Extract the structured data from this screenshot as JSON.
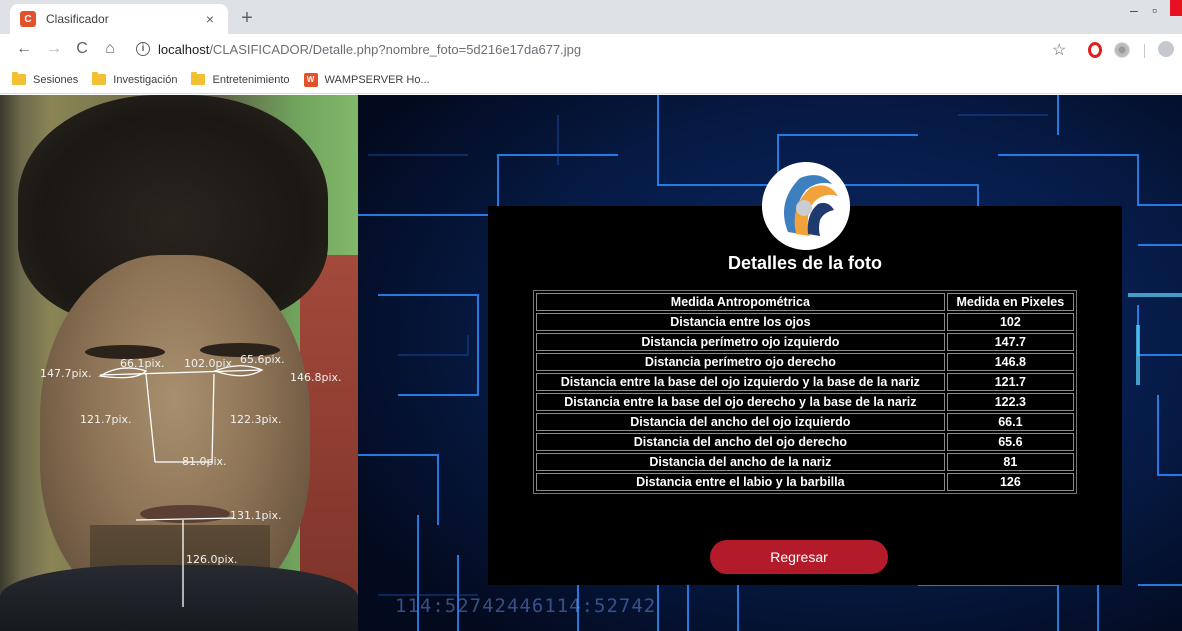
{
  "browser": {
    "tab_title": "Clasificador",
    "tab_favicon_text": "C",
    "url_host": "localhost",
    "url_path": "/CLASIFICADOR/Detalle.php?nombre_foto=5d216e17da677.jpg",
    "bookmarks": [
      {
        "label": "Sesiones",
        "icon": "folder-icon"
      },
      {
        "label": "Investigación",
        "icon": "folder-icon"
      },
      {
        "label": "Entretenimiento",
        "icon": "folder-icon"
      },
      {
        "label": "WAMPSERVER Ho...",
        "icon": "wamp-icon"
      }
    ]
  },
  "photo_overlay": {
    "labels": {
      "left_perimeter": "147.7pix.",
      "left_width": "66.1pix.",
      "eye_distance": "102.0pix.",
      "right_width": "65.6pix.",
      "right_perimeter": "146.8pix.",
      "left_eye_nose": "121.7pix.",
      "right_eye_nose": "122.3pix.",
      "nose_width": "81.0pix.",
      "lip_width": "131.1pix.",
      "lip_chin": "126.0pix."
    }
  },
  "background": {
    "circuit_text": "114:52742446114:52742"
  },
  "panel": {
    "title": "Detalles de la foto",
    "table": {
      "headers": [
        "Medida Antropométrica",
        "Medida en Pixeles"
      ],
      "rows": [
        [
          "Distancia entre los ojos",
          "102"
        ],
        [
          "Distancia perímetro ojo izquierdo",
          "147.7"
        ],
        [
          "Distancia perímetro ojo derecho",
          "146.8"
        ],
        [
          "Distancia entre la base del ojo izquierdo y la base de la nariz",
          "121.7"
        ],
        [
          "Distancia entre la base del ojo derecho y la base de la nariz",
          "122.3"
        ],
        [
          "Distancia del ancho del ojo izquierdo",
          "66.1"
        ],
        [
          "Distancia del ancho del ojo derecho",
          "65.6"
        ],
        [
          "Distancia del ancho de la nariz",
          "81"
        ],
        [
          "Distancia entre el labio y la barbilla",
          "126"
        ]
      ]
    },
    "back_button": "Regresar"
  },
  "colors": {
    "button": "#b31b2b",
    "panel_bg": "#000000",
    "circuit_line": "#2a8cff"
  }
}
